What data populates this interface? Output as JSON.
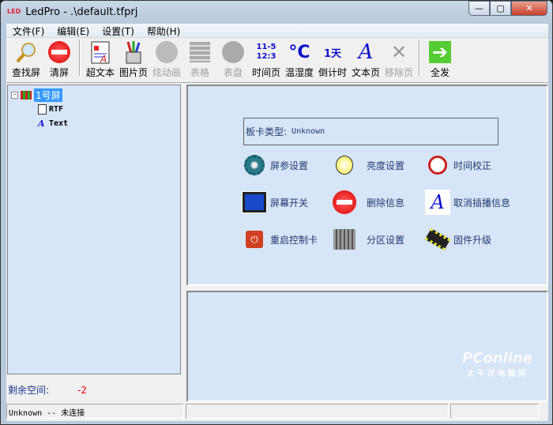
{
  "window": {
    "title": "LedPro - .\\default.tfprj",
    "min": "—",
    "max": "▢",
    "close": "✕"
  },
  "menu": [
    "文件(F)",
    "编辑(E)",
    "设置(T)",
    "帮助(H)"
  ],
  "toolbar": {
    "find": "查找屏",
    "clear": "清屏",
    "rich": "超文本",
    "image": "图片页",
    "anim": "炫动画",
    "table": "表格",
    "clock": "表盘",
    "time": "时间页",
    "time_icon_1": "11-5",
    "time_icon_2": "12:3",
    "temp": "温湿度",
    "temp_icon": "°C",
    "count": "倒计时",
    "count_icon": "1天",
    "text": "文本页",
    "text_icon": "A",
    "remove": "移除页",
    "sendall": "全发"
  },
  "tree": {
    "root": "1号屏",
    "children": [
      "RTF",
      "Text"
    ]
  },
  "left": {
    "space_label": "剩余空间:",
    "space_value": "-2"
  },
  "panel": {
    "card_label": "板卡类型:",
    "card_value": "Unknown",
    "actions": [
      "屏参设置",
      "亮度设置",
      "时间校正",
      "屏幕开关",
      "删除信息",
      "取消插播信息",
      "重启控制卡",
      "分区设置",
      "固件升级"
    ]
  },
  "status": {
    "text": "Unknown -- 未连接"
  },
  "watermark": {
    "brand": "PConline",
    "sub": "太平洋电脑网"
  }
}
